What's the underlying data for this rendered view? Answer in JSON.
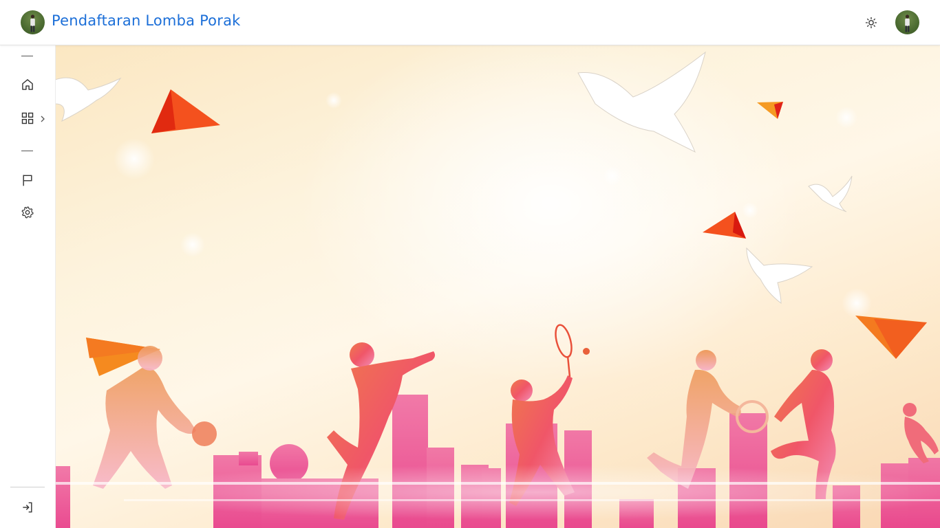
{
  "header": {
    "title": "Pendaftaran Lomba Porak",
    "brand_color": "#1c6fd8",
    "theme_toggle_icon": "sun-icon",
    "avatar_icon": "user-avatar"
  },
  "sidebar": {
    "items": [
      {
        "icon": "home-icon"
      },
      {
        "icon": "grid-icon",
        "has_submenu": true
      },
      {
        "icon": "flag-icon"
      },
      {
        "icon": "gear-icon"
      }
    ],
    "footer_icon": "login-icon"
  },
  "hero": {
    "image": "sports-silhouettes-banner"
  }
}
